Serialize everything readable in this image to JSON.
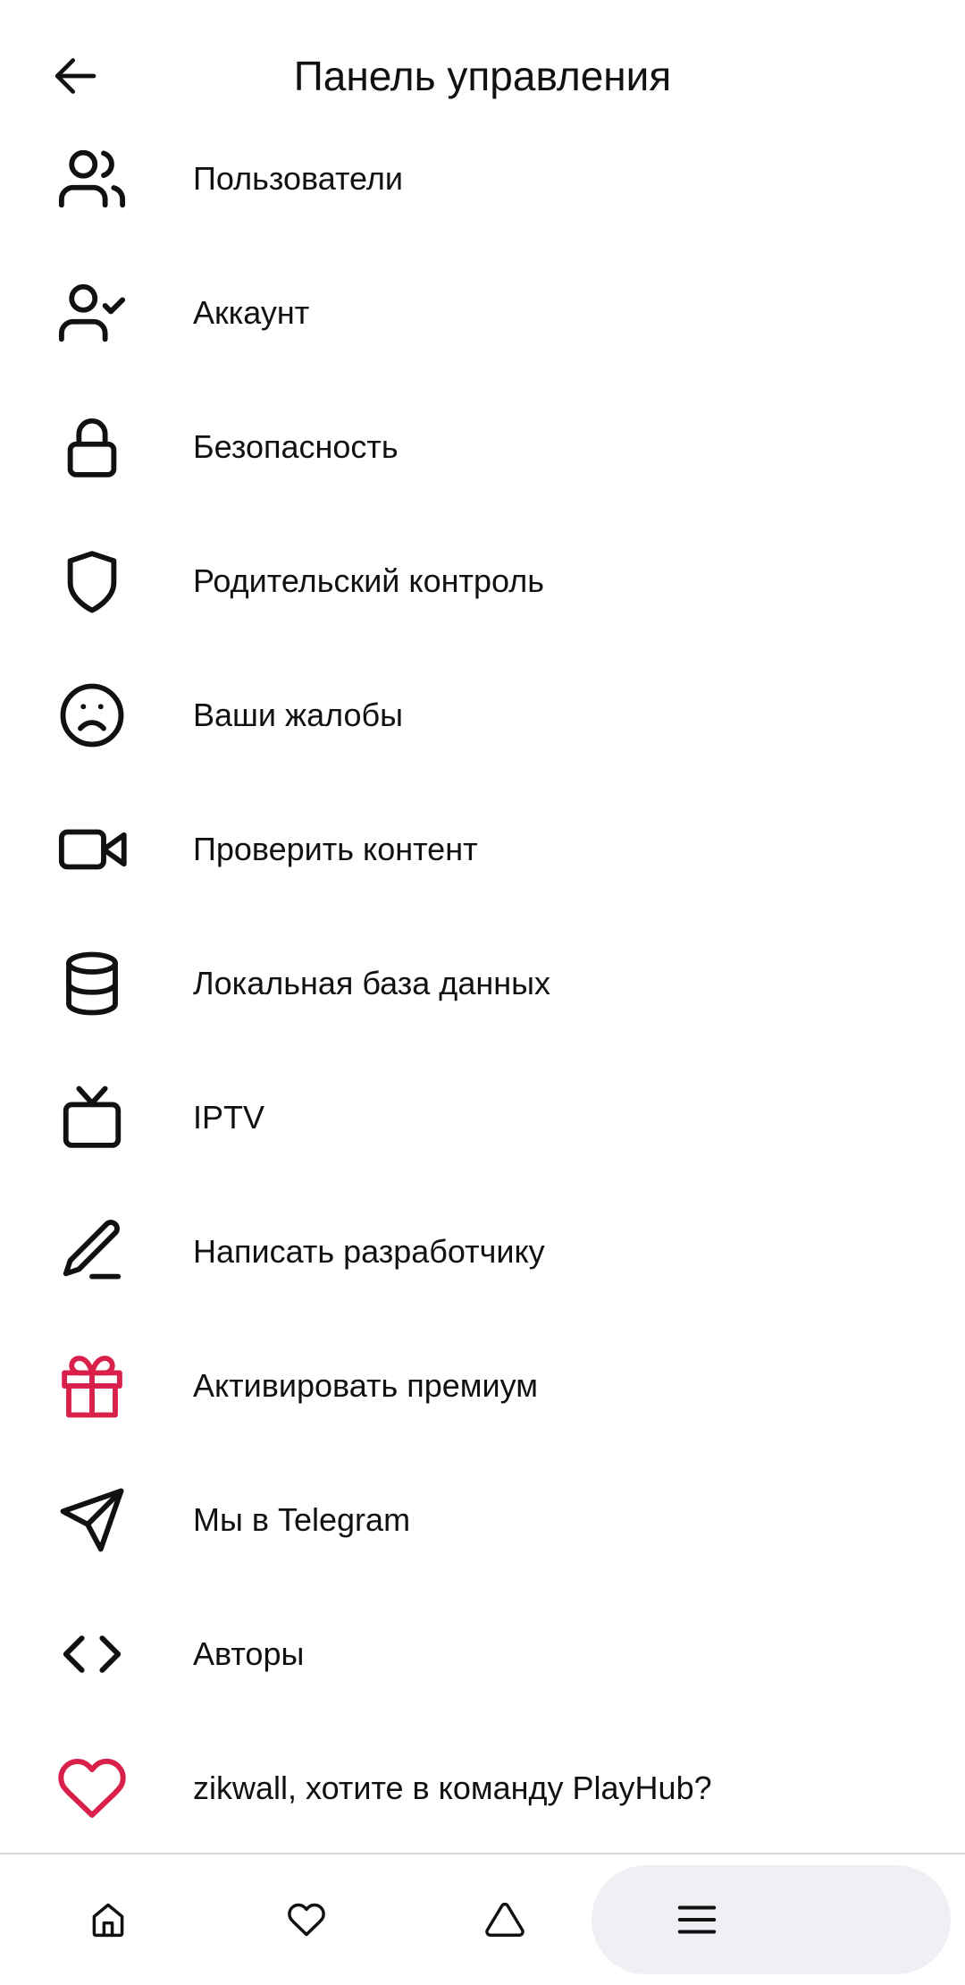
{
  "header": {
    "title": "Панель управления",
    "back_icon": "arrow-left-icon"
  },
  "menu": {
    "items": [
      {
        "label": "Пользователи",
        "icon": "users-icon"
      },
      {
        "label": "Аккаунт",
        "icon": "user-check-icon"
      },
      {
        "label": "Безопасность",
        "icon": "lock-icon"
      },
      {
        "label": "Родительский контроль",
        "icon": "shield-icon"
      },
      {
        "label": "Ваши жалобы",
        "icon": "frown-icon"
      },
      {
        "label": "Проверить контент",
        "icon": "video-icon"
      },
      {
        "label": "Локальная база данных",
        "icon": "database-icon"
      },
      {
        "label": "IPTV",
        "icon": "tv-icon"
      },
      {
        "label": "Написать разработчику",
        "icon": "pen-icon"
      },
      {
        "label": "Активировать премиум",
        "icon": "gift-icon",
        "color": "#d8204a"
      },
      {
        "label": "Мы в Telegram",
        "icon": "send-icon"
      },
      {
        "label": "Авторы",
        "icon": "code-icon"
      },
      {
        "label": "zikwall, хотите в команду PlayHub?",
        "icon": "heart-icon",
        "color": "#d8204a"
      }
    ]
  },
  "bottom_nav": {
    "items": [
      {
        "name": "home",
        "icon": "home-icon"
      },
      {
        "name": "favorites",
        "icon": "heart-icon"
      },
      {
        "name": "trending",
        "icon": "triangle-icon"
      },
      {
        "name": "menu",
        "icon": "hamburger-menu-icon",
        "active": true
      }
    ],
    "active_background": "#eef0f4"
  },
  "colors": {
    "accent": "#d8204a",
    "text": "#111111",
    "background": "#ffffff"
  }
}
